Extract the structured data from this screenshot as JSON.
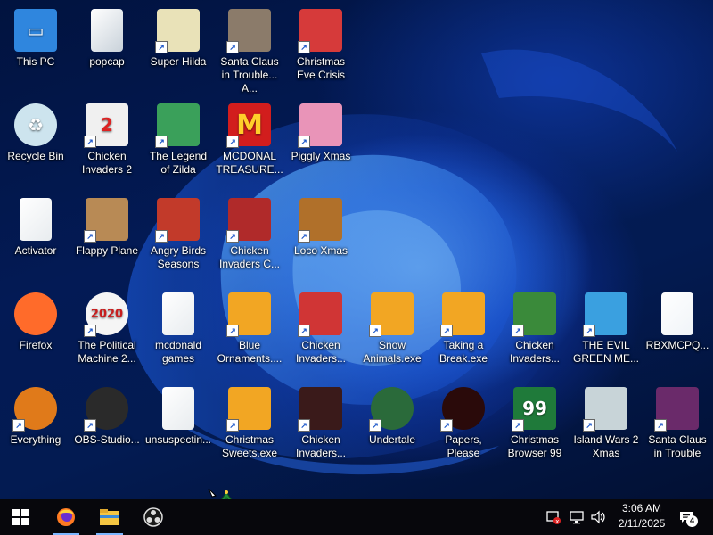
{
  "desktop": {
    "icons": [
      {
        "label": "This PC",
        "icon": "this-pc-icon",
        "color": "#2f86de",
        "glyph": "▭",
        "shortcut": false
      },
      {
        "label": "popcap",
        "icon": "folder-icon",
        "color": "#c9d2da",
        "glyph": "",
        "shortcut": false
      },
      {
        "label": "Super Hilda",
        "icon": "super-hilda-icon",
        "color": "#e9e2b8",
        "glyph": "",
        "shortcut": true
      },
      {
        "label": "Santa Claus in Trouble... A...",
        "icon": "santa-claus-icon",
        "color": "#8b7b6a",
        "glyph": "",
        "shortcut": true
      },
      {
        "label": "Christmas Eve Crisis",
        "icon": "christmas-eve-crisis-icon",
        "color": "#d63a3a",
        "glyph": "",
        "shortcut": true
      },
      {
        "label": "Recycle Bin",
        "icon": "recycle-bin-icon",
        "color": "#cde4ee",
        "glyph": "♻",
        "shortcut": false
      },
      {
        "label": "Chicken Invaders 2",
        "icon": "chicken-invaders-icon",
        "color": "#f0f0f0",
        "glyph": "2",
        "shortcut": true
      },
      {
        "label": "The Legend of Zilda",
        "icon": "legend-of-zilda-icon",
        "color": "#3aa05a",
        "glyph": "",
        "shortcut": true
      },
      {
        "label": "MCDONAL TREASURE...",
        "icon": "mcdonald-icon",
        "color": "#d21d1d",
        "glyph": "M",
        "shortcut": true
      },
      {
        "label": "Piggly Xmas",
        "icon": "piggly-xmas-icon",
        "color": "#e994b8",
        "glyph": "",
        "shortcut": true
      },
      {
        "label": "Activator",
        "icon": "activator-file-icon",
        "color": "#e8ecef",
        "glyph": "",
        "shortcut": false
      },
      {
        "label": "Flappy Plane",
        "icon": "flappy-plane-icon",
        "color": "#b88a55",
        "glyph": "",
        "shortcut": true
      },
      {
        "label": "Angry Birds Seasons",
        "icon": "angry-birds-icon",
        "color": "#c23a2a",
        "glyph": "",
        "shortcut": true
      },
      {
        "label": "Chicken Invaders C...",
        "icon": "chicken-invaders-xmas-icon",
        "color": "#b02a2a",
        "glyph": "",
        "shortcut": true
      },
      {
        "label": "Loco Xmas",
        "icon": "loco-xmas-icon",
        "color": "#b0702a",
        "glyph": "",
        "shortcut": true
      },
      {
        "label": "Firefox",
        "icon": "firefox-icon",
        "color": "#ff6b2a",
        "glyph": "",
        "shortcut": false
      },
      {
        "label": "The Political Machine 2...",
        "icon": "political-machine-icon",
        "color": "#f5f5f5",
        "glyph": "2020",
        "shortcut": true
      },
      {
        "label": "mcdonald games",
        "icon": "folder-icon",
        "color": "#e8ecef",
        "glyph": "",
        "shortcut": false
      },
      {
        "label": "Blue Ornaments....",
        "icon": "blue-ornaments-exe-icon",
        "color": "#f2a623",
        "glyph": "",
        "shortcut": true
      },
      {
        "label": "Chicken Invaders...",
        "icon": "chicken-invaders-icon",
        "color": "#d03535",
        "glyph": "",
        "shortcut": true
      },
      {
        "label": "Snow Animals.exe",
        "icon": "snow-animals-exe-icon",
        "color": "#f2a623",
        "glyph": "",
        "shortcut": true
      },
      {
        "label": "Taking a Break.exe",
        "icon": "taking-a-break-exe-icon",
        "color": "#f2a623",
        "glyph": "",
        "shortcut": true
      },
      {
        "label": "Chicken Invaders...",
        "icon": "chicken-invaders-icon",
        "color": "#3a8a3a",
        "glyph": "",
        "shortcut": true
      },
      {
        "label": "THE EVIL GREEN ME...",
        "icon": "messenger-icon",
        "color": "#3aa0e0",
        "glyph": "",
        "shortcut": true
      },
      {
        "label": "RBXMCPQ...",
        "icon": "window-file-icon",
        "color": "#f0f4f8",
        "glyph": "",
        "shortcut": false
      },
      {
        "label": "Everything",
        "icon": "everything-search-icon",
        "color": "#e07a1a",
        "glyph": "",
        "shortcut": true
      },
      {
        "label": "OBS-Studio...",
        "icon": "obs-studio-icon",
        "color": "#2a2a2a",
        "glyph": "",
        "shortcut": true
      },
      {
        "label": "unsuspectin...",
        "icon": "folder-icon",
        "color": "#e8ecef",
        "glyph": "",
        "shortcut": false
      },
      {
        "label": "Christmas Sweets.exe",
        "icon": "christmas-sweets-exe-icon",
        "color": "#f2a623",
        "glyph": "",
        "shortcut": true
      },
      {
        "label": "Chicken Invaders...",
        "icon": "chicken-invaders-icon",
        "color": "#3a1a1a",
        "glyph": "",
        "shortcut": true
      },
      {
        "label": "Undertale",
        "icon": "undertale-icon",
        "color": "#2a6a3a",
        "glyph": "",
        "shortcut": true
      },
      {
        "label": "Papers, Please",
        "icon": "papers-please-icon",
        "color": "#2a0a0a",
        "glyph": "",
        "shortcut": true
      },
      {
        "label": "Christmas Browser 99",
        "icon": "christmas-browser-icon",
        "color": "#1f7a3a",
        "glyph": "99",
        "shortcut": true
      },
      {
        "label": "Island Wars 2 Xmas",
        "icon": "island-wars-icon",
        "color": "#c8d4d8",
        "glyph": "",
        "shortcut": true
      },
      {
        "label": "Santa Claus in Trouble",
        "icon": "santa-claus-icon",
        "color": "#6a2a6a",
        "glyph": "",
        "shortcut": true
      }
    ]
  },
  "cursor": {
    "icon": "christmas-tree-cursor-icon"
  },
  "taskbar": {
    "start_icon": "windows-start-icon",
    "pinned": [
      {
        "name": "firefox-icon",
        "active": true
      },
      {
        "name": "file-explorer-icon",
        "active": true
      },
      {
        "name": "obs-studio-icon",
        "active": false
      }
    ],
    "tray": {
      "icons": [
        "security-alert-icon",
        "network-icon",
        "volume-icon"
      ],
      "time": "3:06 AM",
      "date": "2/11/2025",
      "notifications": "4"
    }
  }
}
